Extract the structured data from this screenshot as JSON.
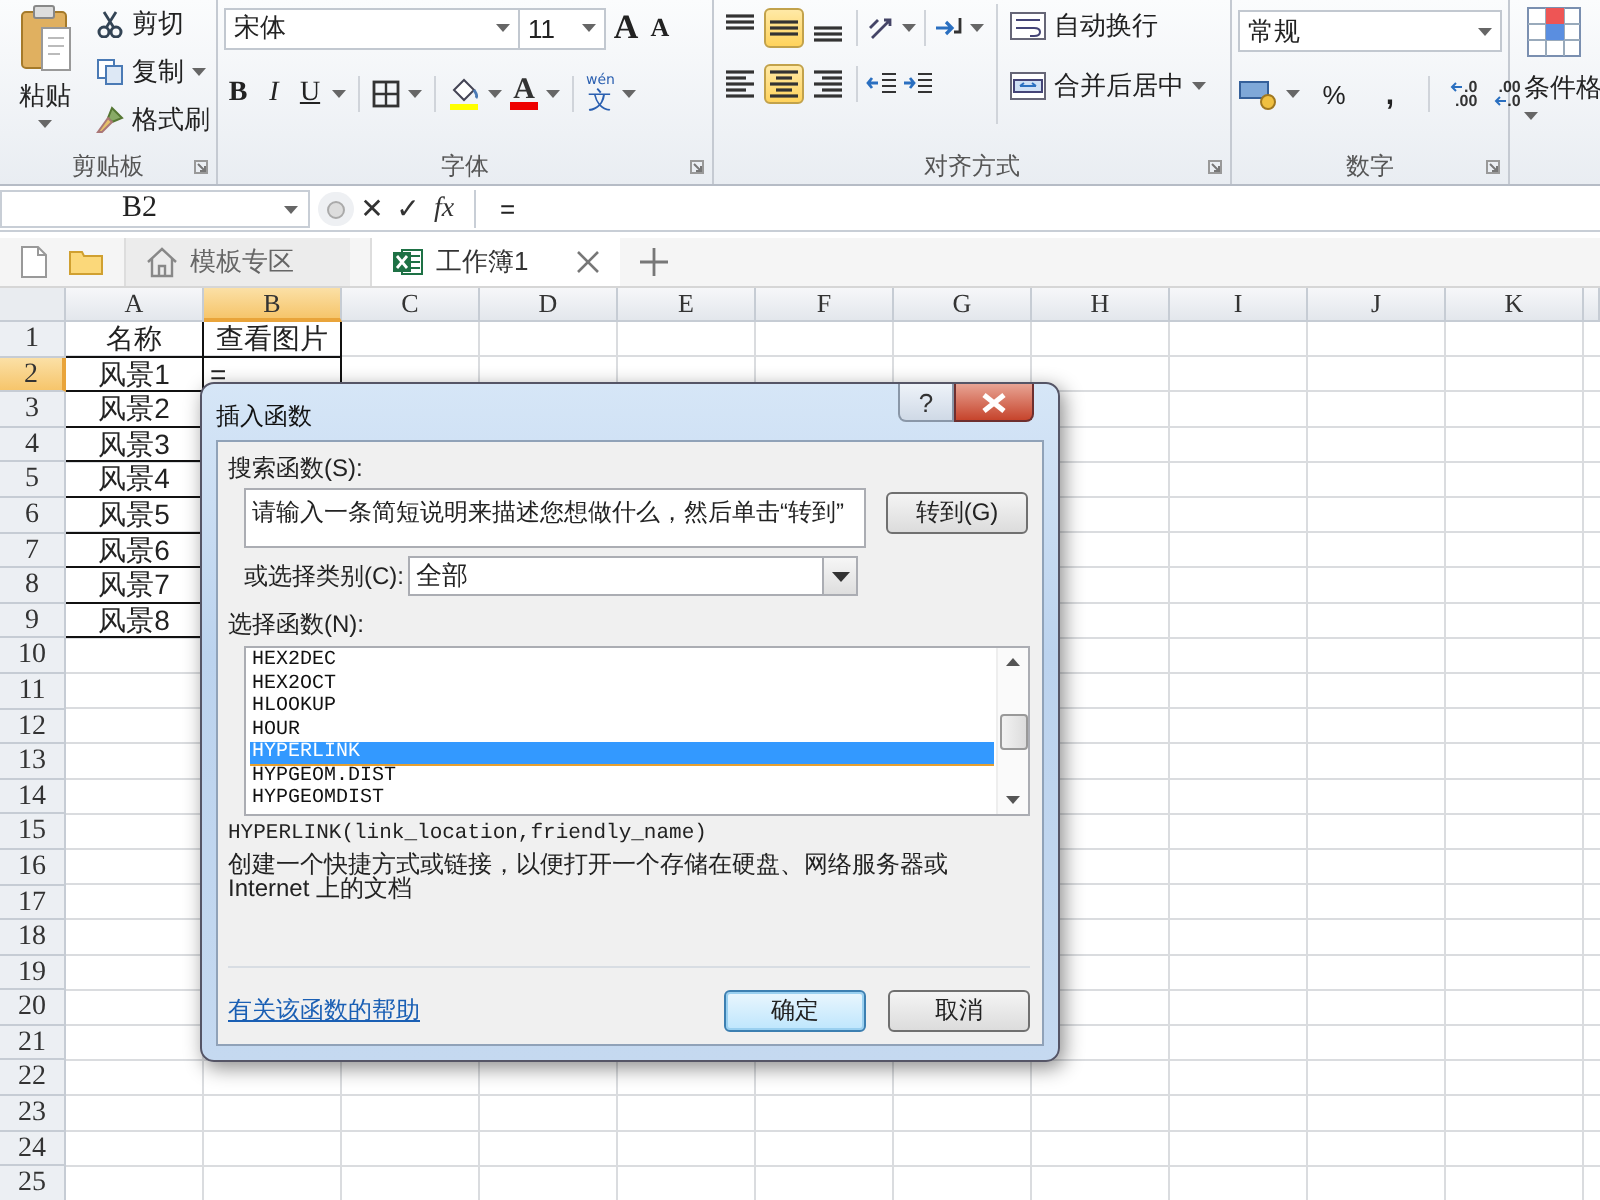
{
  "ribbon": {
    "clipboard": {
      "label": "剪贴板",
      "paste": "粘贴",
      "cut": "剪切",
      "copy": "复制",
      "format_painter": "格式刷"
    },
    "font": {
      "label": "字体",
      "font_name": "宋体",
      "font_size": "11",
      "grow": "A",
      "shrink": "A",
      "bold": "B",
      "italic": "I",
      "underline": "U",
      "font_color": "A",
      "phonetic_guide": "wén",
      "phonetic": "文"
    },
    "alignment": {
      "label": "对齐方式",
      "vertical": [
        {
          "selected": false
        },
        {
          "selected": true
        },
        {
          "selected": false
        }
      ],
      "horizontal": [
        {
          "selected": false
        },
        {
          "selected": true
        },
        {
          "selected": false
        }
      ],
      "wrap_text": "自动换行",
      "merge_center": "合并后居中"
    },
    "number": {
      "label": "数字",
      "format": "常规",
      "percent": "%",
      "comma": ",",
      "increase_decimal": [
        ".0",
        ".00"
      ],
      "decrease_decimal": [
        ".00",
        ".0"
      ]
    },
    "styles": {
      "conditional_format": "条件格"
    }
  },
  "formula_bar": {
    "name_box": "B2",
    "cancel": "✕",
    "enter": "✓",
    "function": "fx",
    "formula": "="
  },
  "tabs": [
    {
      "label": "模板专区",
      "kind": "home",
      "selected": false
    },
    {
      "label": "工作簿1",
      "kind": "workbook",
      "selected": true
    }
  ],
  "sheet": {
    "columns": [
      {
        "label": "A",
        "selected": false
      },
      {
        "label": "B",
        "selected": true
      },
      {
        "label": "C",
        "selected": false
      },
      {
        "label": "D",
        "selected": false
      },
      {
        "label": "E",
        "selected": false
      },
      {
        "label": "F",
        "selected": false
      },
      {
        "label": "G",
        "selected": false
      },
      {
        "label": "H",
        "selected": false
      },
      {
        "label": "I",
        "selected": false
      },
      {
        "label": "J",
        "selected": false
      },
      {
        "label": "K",
        "selected": false
      }
    ],
    "rows": [
      {
        "label": "1",
        "selected": false,
        "cells": [
          "名称",
          "查看图片"
        ]
      },
      {
        "label": "2",
        "selected": true,
        "cells": [
          "风景1",
          "="
        ]
      },
      {
        "label": "3",
        "selected": false,
        "cells": [
          "风景2"
        ]
      },
      {
        "label": "4",
        "selected": false,
        "cells": [
          "风景3"
        ]
      },
      {
        "label": "5",
        "selected": false,
        "cells": [
          "风景4"
        ]
      },
      {
        "label": "6",
        "selected": false,
        "cells": [
          "风景5"
        ]
      },
      {
        "label": "7",
        "selected": false,
        "cells": [
          "风景6"
        ]
      },
      {
        "label": "8",
        "selected": false,
        "cells": [
          "风景7"
        ]
      },
      {
        "label": "9",
        "selected": false,
        "cells": [
          "风景8"
        ]
      },
      {
        "label": "10",
        "selected": false
      },
      {
        "label": "11",
        "selected": false
      },
      {
        "label": "12",
        "selected": false
      },
      {
        "label": "13",
        "selected": false
      },
      {
        "label": "14",
        "selected": false
      },
      {
        "label": "15",
        "selected": false
      },
      {
        "label": "16",
        "selected": false
      },
      {
        "label": "17",
        "selected": false
      },
      {
        "label": "18",
        "selected": false
      },
      {
        "label": "19",
        "selected": false
      },
      {
        "label": "20",
        "selected": false
      },
      {
        "label": "21",
        "selected": false
      },
      {
        "label": "22",
        "selected": false
      },
      {
        "label": "23",
        "selected": false
      },
      {
        "label": "24",
        "selected": false
      },
      {
        "label": "25",
        "selected": false
      }
    ]
  },
  "dialog": {
    "title": "插入函数",
    "help_button": "?",
    "search_label": "搜索函数(S):",
    "search_value": "请输入一条简短说明来描述您想做什么，然后单击“转到”",
    "go_button": "转到(G)",
    "category_label": "或选择类别(C):",
    "category": "全部",
    "function_label": "选择函数(N):",
    "functions": [
      {
        "name": "HEX2DEC",
        "selected": false
      },
      {
        "name": "HEX2OCT",
        "selected": false
      },
      {
        "name": "HLOOKUP",
        "selected": false
      },
      {
        "name": "HOUR",
        "selected": false
      },
      {
        "name": "HYPERLINK",
        "selected": true
      },
      {
        "name": "HYPGEOM.DIST",
        "selected": false
      },
      {
        "name": "HYPGEOMDIST",
        "selected": false
      }
    ],
    "signature": "HYPERLINK(link_location,friendly_name)",
    "description": "创建一个快捷方式或链接，以便打开一个存储在硬盘、网络服务器或 Internet 上的文档",
    "help_link": "有关该函数的帮助",
    "ok_button": "确定",
    "cancel_button": "取消"
  }
}
